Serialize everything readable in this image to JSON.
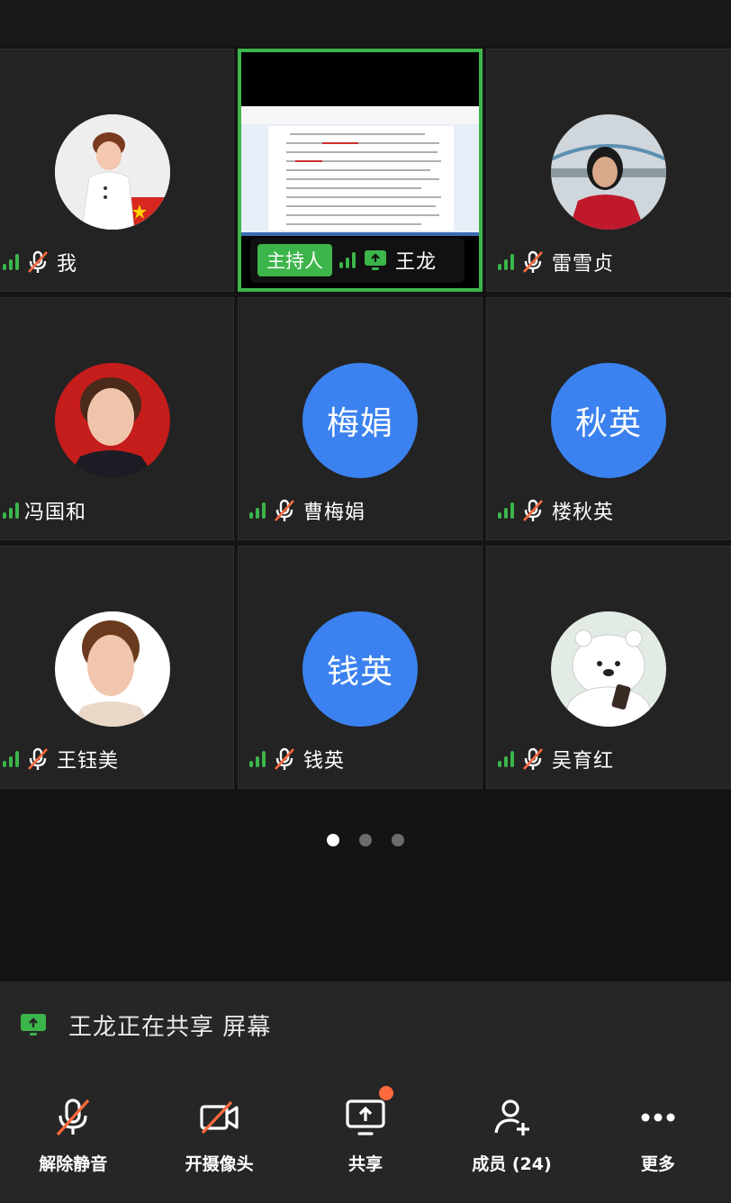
{
  "participants": [
    {
      "name": "我",
      "avatar": "photo",
      "muted": true
    },
    {
      "name": "王龙",
      "role": "主持人",
      "sharing": true
    },
    {
      "name": "雷雪贞",
      "avatar": "photo",
      "muted": true
    },
    {
      "name": "冯国和",
      "avatar": "photo",
      "muted": false
    },
    {
      "name": "曹梅娟",
      "avatar_text": "梅娟",
      "muted": true
    },
    {
      "name": "楼秋英",
      "avatar_text": "秋英",
      "muted": true
    },
    {
      "name": "王钰美",
      "avatar": "photo",
      "muted": true
    },
    {
      "name": "钱英",
      "avatar_text": "钱英",
      "muted": true
    },
    {
      "name": "吴育红",
      "avatar": "photo",
      "muted": true
    }
  ],
  "page_dots": {
    "count": 3,
    "active": 0
  },
  "share_banner": {
    "text": "王龙正在共享 屏幕",
    "icon": "screen-share-icon"
  },
  "toolbar": {
    "unmute": "解除静音",
    "camera": "开摄像头",
    "share": "共享",
    "members": "成员 (24)",
    "more": "更多"
  },
  "colors": {
    "accent_green": "#3cb54a",
    "avatar_blue": "#3b82f0",
    "notification": "#ff6a3d"
  }
}
